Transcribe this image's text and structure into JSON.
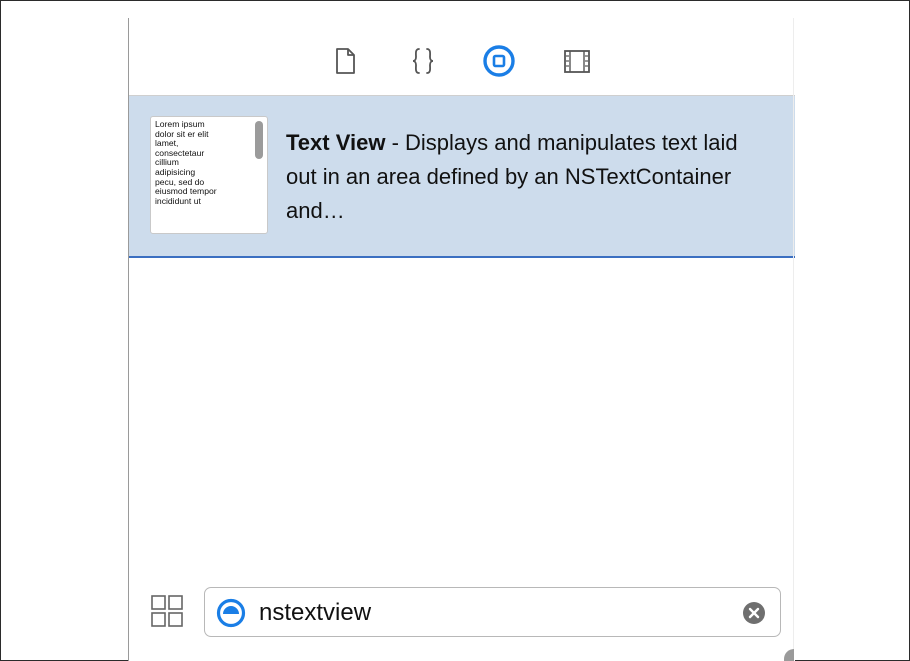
{
  "toolbar": {
    "icons": [
      {
        "name": "file-template-icon",
        "selected": false
      },
      {
        "name": "code-snippet-icon",
        "selected": false
      },
      {
        "name": "object-library-icon",
        "selected": true
      },
      {
        "name": "media-library-icon",
        "selected": false
      }
    ],
    "accent_color": "#1a7ee6"
  },
  "result": {
    "title": "Text View",
    "separator": " - ",
    "description": "Displays and manipulates text laid out in an area defined by an NSTextContainer and…",
    "thumbnail_text": "Lorem ipsum\ndolor sit er elit\nlamet,\nconsectetaur\ncillium\nadipisicing\npecu, sed do\neiusmod tempor\nincididunt ut",
    "selected_background": "#cddcec",
    "selected_border": "#3b6fc1"
  },
  "bottom_bar": {
    "view_toggle_icon": "grid-icon",
    "search": {
      "filter_icon": "object-library-filter-icon",
      "value": "nstextview",
      "clear_icon": "clear-icon"
    }
  }
}
